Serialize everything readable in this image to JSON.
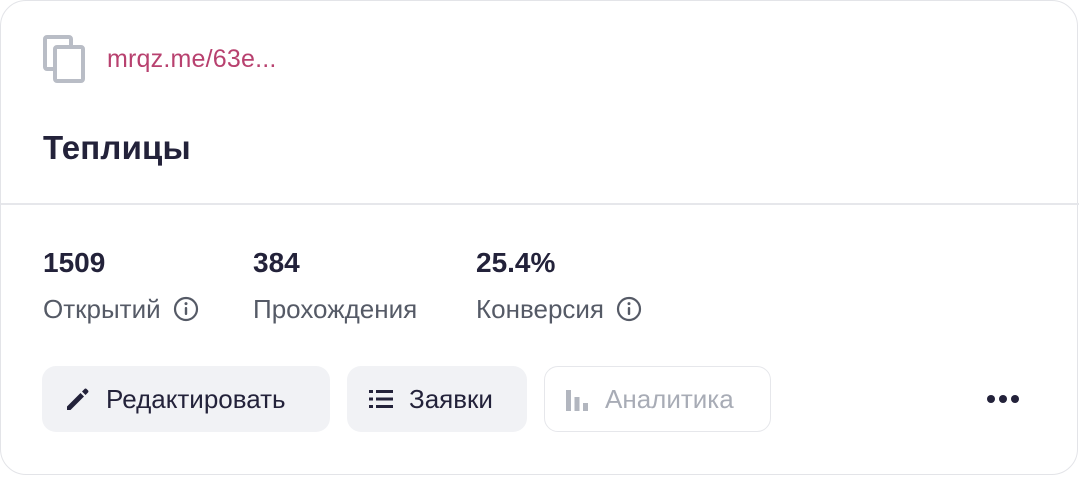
{
  "card": {
    "link": "mrqz.me/63e...",
    "title": "Теплицы",
    "colors": {
      "link": "#b8416f",
      "title": "#23223a",
      "muted": "#555a66",
      "disabled": "#a8acb6",
      "button_bg": "#f1f2f5"
    }
  },
  "stats": [
    {
      "value": "1509",
      "label": "Открытий",
      "icon": "info-icon"
    },
    {
      "value": "384",
      "label": "Прохождения"
    },
    {
      "value": "25.4%",
      "label": "Конверсия",
      "icon": "info-icon"
    }
  ],
  "actions": {
    "edit": {
      "label": "Редактировать",
      "icon": "pencil-icon"
    },
    "leads": {
      "label": "Заявки",
      "icon": "list-icon"
    },
    "analytics": {
      "label": "Аналитика",
      "icon": "bar-chart-icon",
      "disabled": true
    },
    "more": {
      "icon": "more-dots-icon"
    }
  }
}
